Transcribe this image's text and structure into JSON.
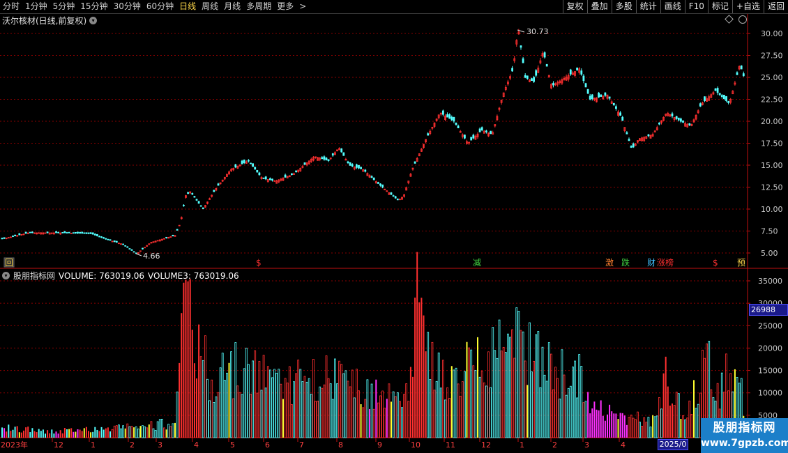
{
  "toolbar": {
    "periods": [
      {
        "label": "分时",
        "active": false
      },
      {
        "label": "1分钟",
        "active": false
      },
      {
        "label": "5分钟",
        "active": false
      },
      {
        "label": "15分钟",
        "active": false
      },
      {
        "label": "30分钟",
        "active": false
      },
      {
        "label": "60分钟",
        "active": false
      },
      {
        "label": "日线",
        "active": true
      },
      {
        "label": "周线",
        "active": false
      },
      {
        "label": "月线",
        "active": false
      },
      {
        "label": "多周期",
        "active": false
      },
      {
        "label": "更多",
        "active": false
      }
    ],
    "more_arrow": ">",
    "right_buttons": [
      "复权",
      "叠加",
      "多股",
      "统计",
      "画线",
      "F10",
      "标记",
      "+自选",
      "返回"
    ]
  },
  "main_chart": {
    "title": "沃尔核材(日线,前复权)",
    "high_label": "30.73",
    "low_label": "4.66",
    "y_ticks": [
      "30.00",
      "27.50",
      "25.00",
      "22.50",
      "20.00",
      "17.50",
      "15.00",
      "12.50",
      "10.00",
      "7.50",
      "5.00"
    ],
    "markers": [
      {
        "text": "回",
        "color": "#ffd84a",
        "bg": "#333"
      },
      {
        "text": "$",
        "color": "#ff3030"
      },
      {
        "text": "减",
        "color": "#40d040"
      },
      {
        "text": "激",
        "color": "#ff8030"
      },
      {
        "text": "跌",
        "color": "#40d040"
      },
      {
        "text": "财",
        "color": "#40c0ff"
      },
      {
        "text": "涨榜",
        "color": "#ff3030"
      },
      {
        "text": "$",
        "color": "#ff3030"
      },
      {
        "text": "预",
        "color": "#ffd84a"
      }
    ]
  },
  "indicator": {
    "name": "股朋指标网",
    "volume_label": "VOLUME: 763019.06",
    "volume3_label": "VOLUME3: 763019.06",
    "y_ticks": [
      "35000",
      "30000",
      "25000",
      "20000",
      "15000",
      "10000",
      "5000"
    ],
    "current_value": "26988"
  },
  "x_axis": {
    "labels": [
      "2023年",
      "12",
      "1",
      "2",
      "3",
      "4",
      "5",
      "6",
      "7",
      "8",
      "9",
      "10",
      "11",
      "12",
      "1",
      "2",
      "3",
      "4"
    ],
    "current_date": "2025/0"
  },
  "watermark": {
    "line1": "股朋指标网",
    "line2": "www.7gpzb.com"
  },
  "colors": {
    "up": "#ff3030",
    "down": "#54ffff",
    "grid": "#8a0000",
    "axis": "#c01010",
    "highlight": "#ffff30",
    "magenta": "#ff30ff"
  }
}
